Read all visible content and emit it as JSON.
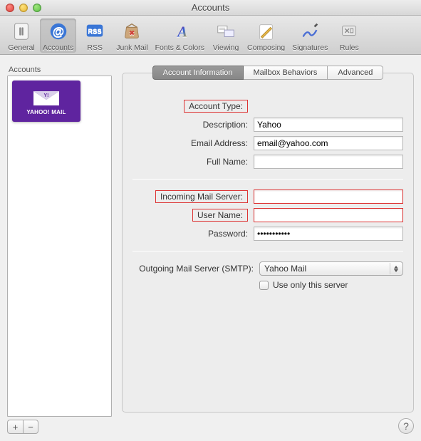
{
  "window": {
    "title": "Accounts"
  },
  "toolbar": [
    {
      "id": "general",
      "label": "General"
    },
    {
      "id": "accounts",
      "label": "Accounts"
    },
    {
      "id": "rss",
      "label": "RSS"
    },
    {
      "id": "junk",
      "label": "Junk Mail"
    },
    {
      "id": "fonts",
      "label": "Fonts & Colors"
    },
    {
      "id": "viewing",
      "label": "Viewing"
    },
    {
      "id": "composing",
      "label": "Composing"
    },
    {
      "id": "signatures",
      "label": "Signatures"
    },
    {
      "id": "rules",
      "label": "Rules"
    }
  ],
  "sidebar": {
    "title": "Accounts",
    "items": [
      {
        "provider_label": "YAHOO! MAIL"
      }
    ],
    "add_glyph": "+",
    "remove_glyph": "−"
  },
  "tabs": [
    {
      "id": "info",
      "label": "Account Information"
    },
    {
      "id": "mailbox",
      "label": "Mailbox Behaviors"
    },
    {
      "id": "advanced",
      "label": "Advanced"
    }
  ],
  "form": {
    "account_type": {
      "label": "Account Type:",
      "value": ""
    },
    "description": {
      "label": "Description:",
      "value": "Yahoo"
    },
    "email": {
      "label": "Email Address:",
      "value": "email@yahoo.com"
    },
    "full_name": {
      "label": "Full Name:",
      "value": ""
    },
    "incoming": {
      "label": "Incoming Mail Server:",
      "value": ""
    },
    "user_name": {
      "label": "User Name:",
      "value": ""
    },
    "password": {
      "label": "Password:",
      "value": "•••••••••••"
    },
    "smtp": {
      "label": "Outgoing Mail Server (SMTP):",
      "value": "Yahoo Mail"
    },
    "use_only": {
      "label": "Use only this server"
    }
  },
  "help_glyph": "?"
}
